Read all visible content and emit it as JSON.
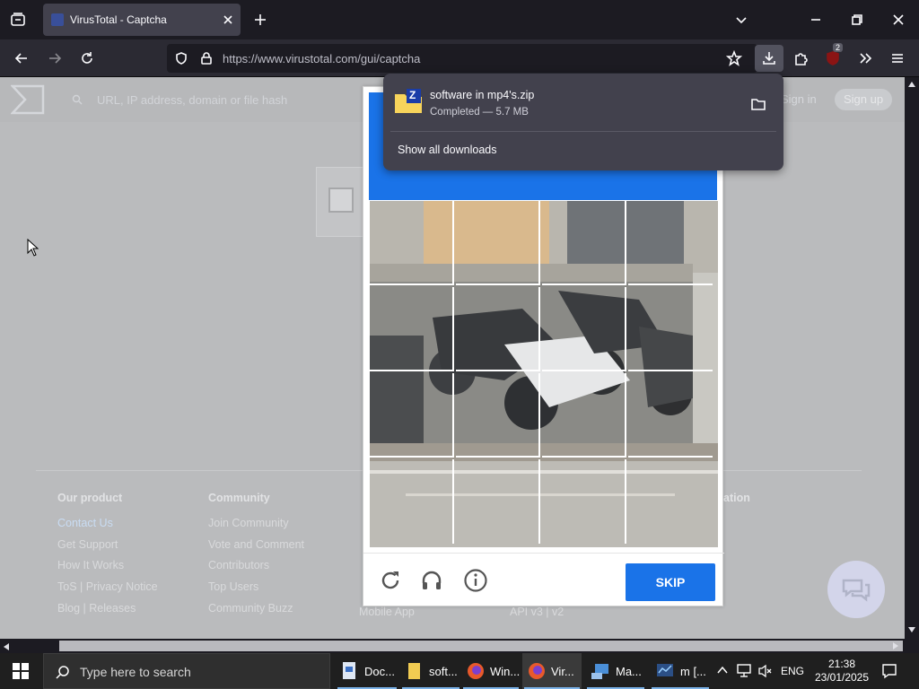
{
  "browser": {
    "tab_title": "VirusTotal - Captcha",
    "url": "https://www.virustotal.com/gui/captcha",
    "extension_badge": "2"
  },
  "downloads": {
    "filename": "software in mp4's.zip",
    "status": "Completed — 5.7 MB",
    "show_all": "Show all downloads",
    "file_badge": "Z"
  },
  "vt": {
    "search_placeholder": "URL, IP address, domain or file hash",
    "sign_in": "Sign in",
    "sign_up": "Sign up"
  },
  "footer": {
    "col1": {
      "heading": "Our product",
      "links": [
        "Contact Us",
        "Get Support",
        "How It Works",
        "ToS | Privacy Notice",
        "Blog | Releases"
      ]
    },
    "col2": {
      "heading": "Community",
      "links": [
        "Join Community",
        "Vote and Comment",
        "Contributors",
        "Top Users",
        "Community Buzz"
      ]
    },
    "col3": {
      "last_link": "Mobile App"
    },
    "col4": {
      "heading_fragment": "ation",
      "last_link": "API v3 | v2"
    }
  },
  "captcha": {
    "skip": "SKIP"
  },
  "taskbar": {
    "search_placeholder": "Type here to search",
    "apps": [
      "Doc...",
      "soft...",
      "Win...",
      "Vir...",
      "Ma...",
      "m [..."
    ],
    "language": "ENG",
    "time": "21:38",
    "date": "23/01/2025"
  },
  "colors": {
    "captcha_blue": "#1a73e8",
    "browser_dark": "#1c1b22",
    "page_overlay": "#babbbd"
  }
}
